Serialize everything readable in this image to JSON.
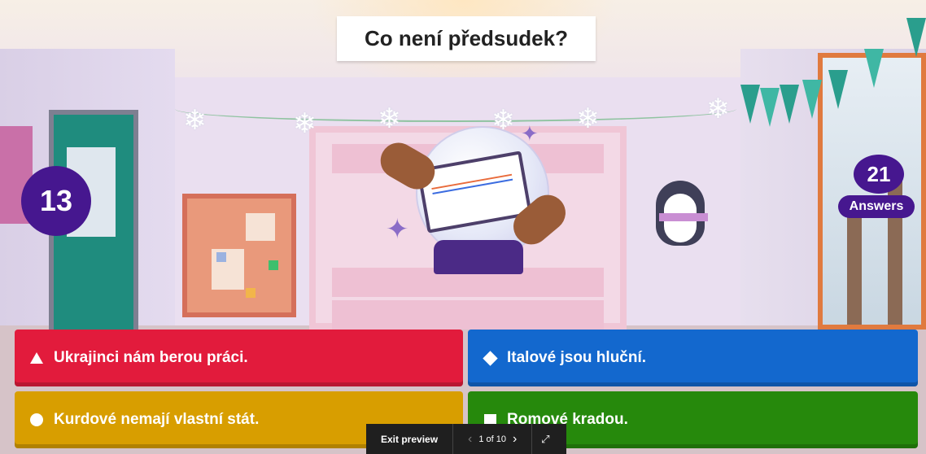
{
  "question": {
    "text": "Co není předsudek?"
  },
  "timer": {
    "value": "13"
  },
  "answers_counter": {
    "count": "21",
    "label": "Answers"
  },
  "options": [
    {
      "shape": "triangle",
      "text": "Ukrajinci nám berou práci.",
      "color": "#e21b3c"
    },
    {
      "shape": "diamond",
      "text": "Italové jsou hluční.",
      "color": "#1368ce"
    },
    {
      "shape": "circle",
      "text": "Kurdové nemají vlastní stát.",
      "color": "#d89e00"
    },
    {
      "shape": "square",
      "text": "Romové kradou.",
      "color": "#26890c"
    }
  ],
  "preview_bar": {
    "exit_label": "Exit preview",
    "page_text": "1 of 10",
    "prev_icon": "chevron-left-icon",
    "next_icon": "chevron-right-icon",
    "fullscreen_icon": "expand-icon"
  },
  "colors": {
    "accent": "#46178f"
  }
}
